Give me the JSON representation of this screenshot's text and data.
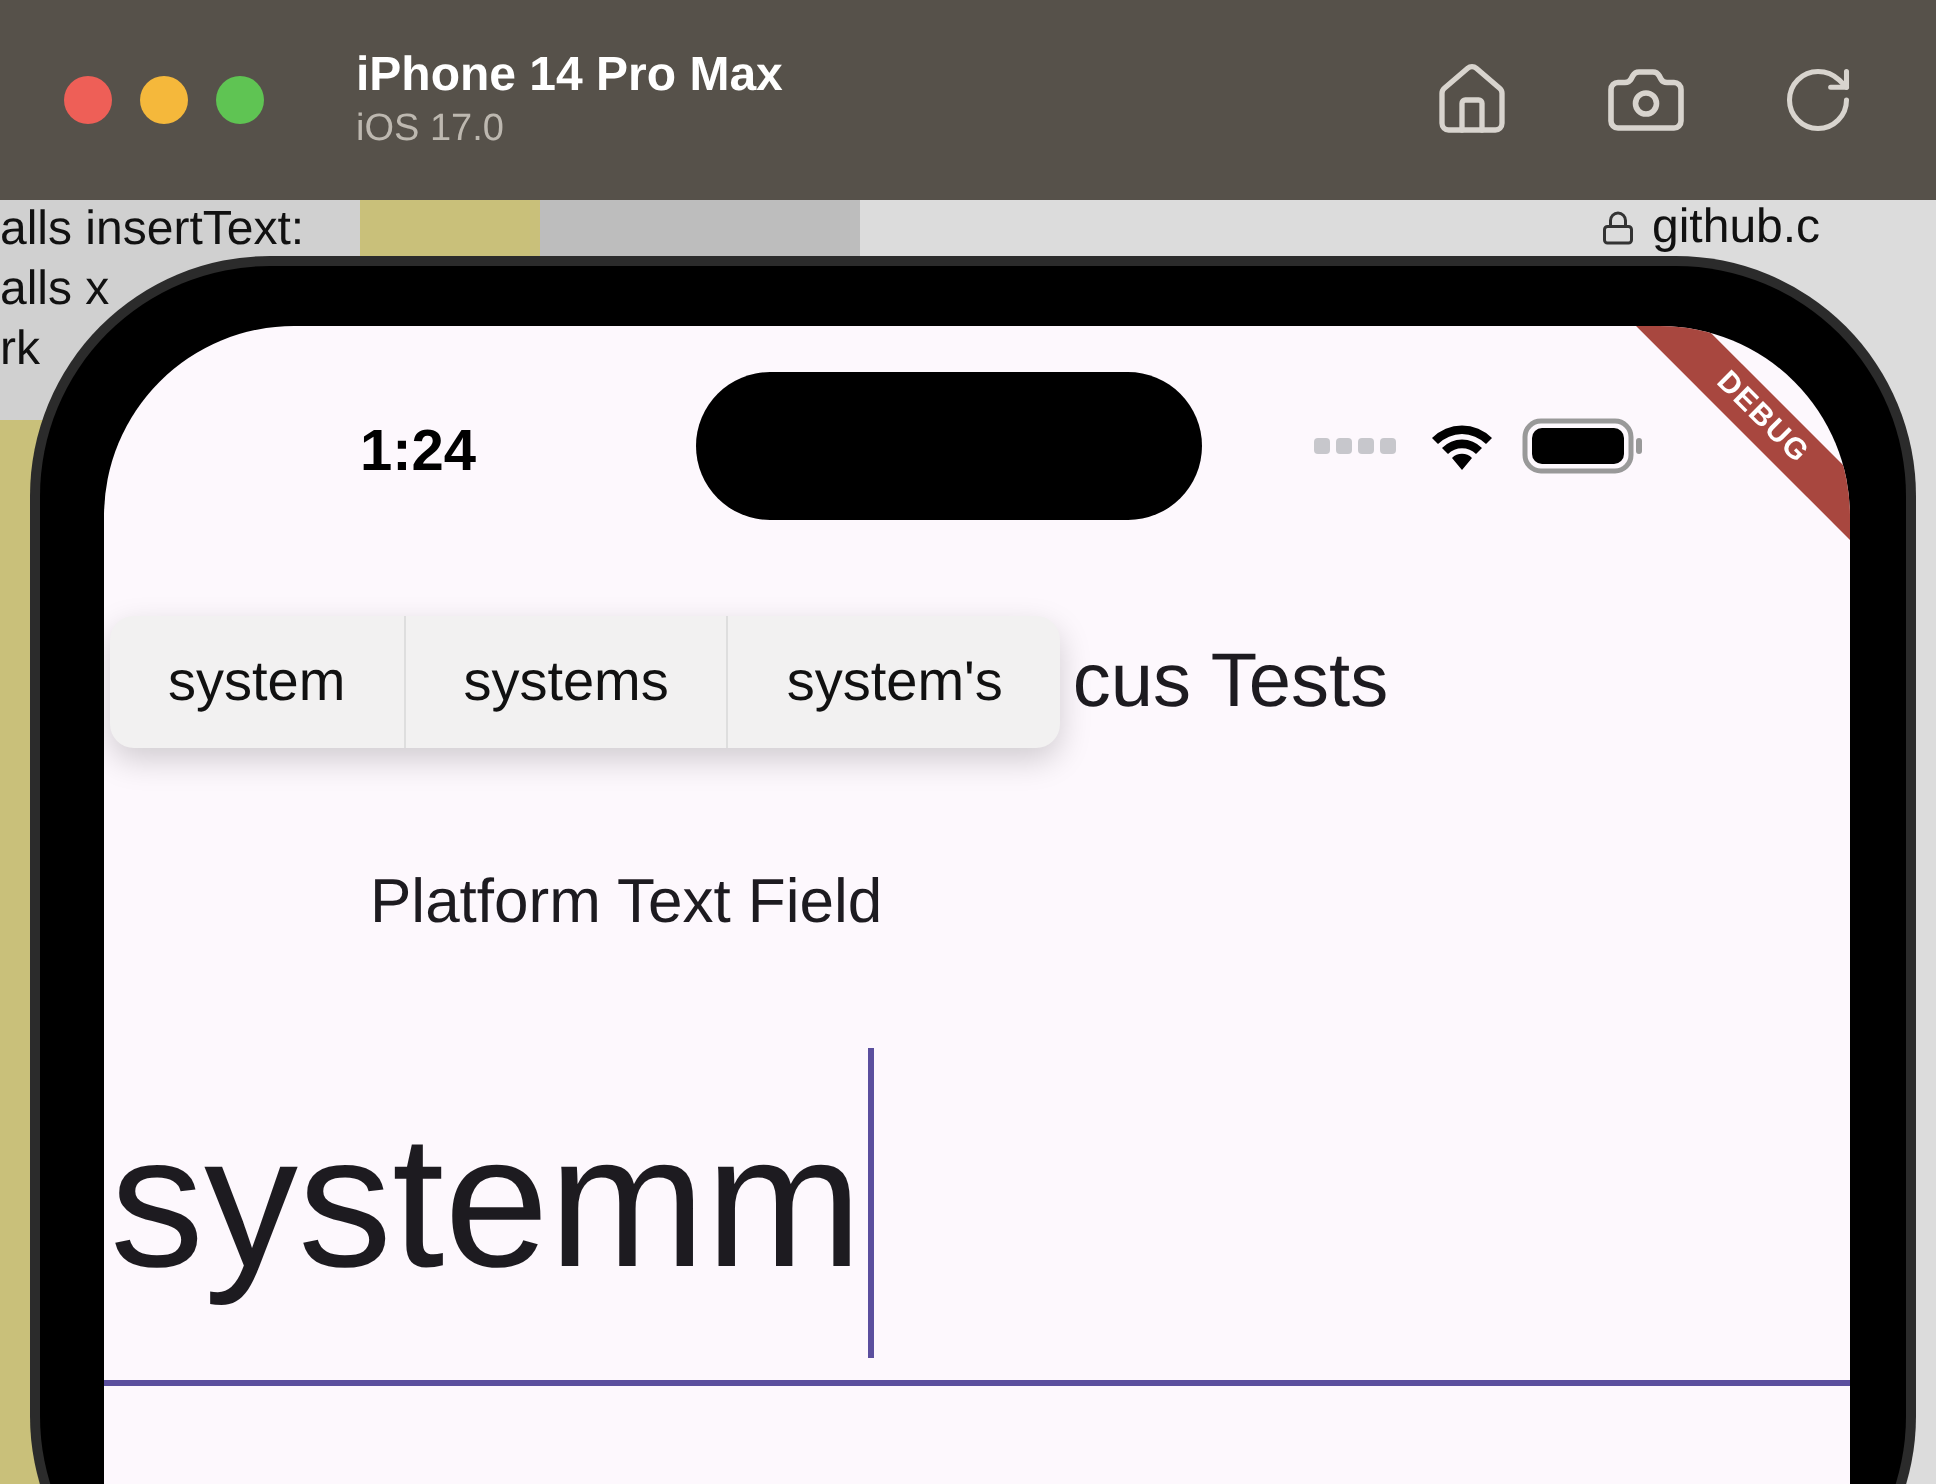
{
  "simulator": {
    "title": "iPhone 14 Pro Max",
    "subtitle": "iOS 17.0"
  },
  "background_window": {
    "lines": [
      "alls insertText:",
      "alls x",
      "rk"
    ],
    "address": "github.c"
  },
  "status_bar": {
    "time": "1:24"
  },
  "debug_banner": "DEBUG",
  "suggestions": [
    {
      "label": "system"
    },
    {
      "label": "systems"
    },
    {
      "label": "system's"
    }
  ],
  "app_bar": {
    "title": "cus Tests"
  },
  "field_label": "Platform Text Field",
  "text_field": {
    "value": "systemm",
    "focused": true
  }
}
